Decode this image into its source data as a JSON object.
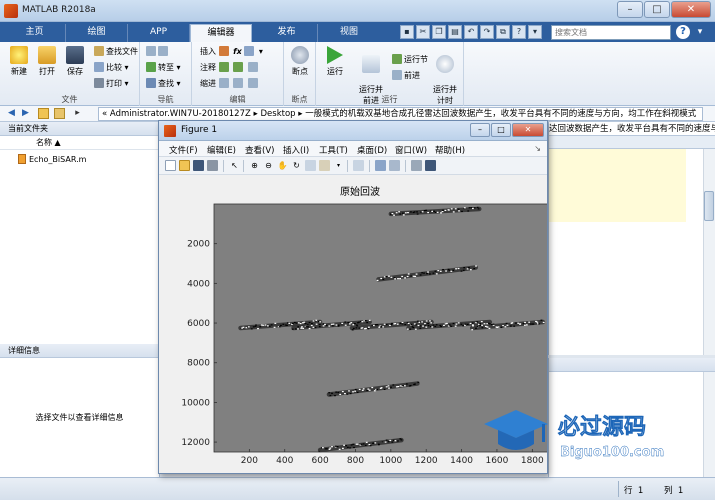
{
  "window": {
    "title": "MATLAB R2018a"
  },
  "tabs": [
    {
      "label": "主页",
      "active": false
    },
    {
      "label": "绘图",
      "active": false
    },
    {
      "label": "APP",
      "active": false
    },
    {
      "label": "编辑器",
      "active": true
    },
    {
      "label": "发布",
      "active": false
    },
    {
      "label": "视图",
      "active": false
    }
  ],
  "search": {
    "placeholder": "搜索文档"
  },
  "ribbon": {
    "file_group": {
      "label": "文件",
      "new": "新建",
      "open": "打开",
      "save": "保存",
      "find_files": "查找文件",
      "compare": "比较",
      "print": "打印"
    },
    "nav_group": {
      "label": "导航",
      "goto": "转至",
      "find": "查找"
    },
    "edit_group": {
      "label": "编辑",
      "insert": "插入",
      "comment": "注释",
      "indent": "缩进",
      "fx": "fx"
    },
    "breakpoint_group": {
      "label": "断点",
      "breakpoints": "断点"
    },
    "run_group": {
      "label": "运行",
      "run": "运行",
      "run_advance": "运行并\n前进",
      "run_section": "运行节",
      "advance": "前进",
      "run_time": "运行并\n计时"
    }
  },
  "address": {
    "path": "« Administrator.WIN7U-20180127Z  ▸  Desktop  ▸  一般模式的机载双基地合成孔径雷达回波数据产生，收发平台具有不同的速度与方向，均工作在斜视模式"
  },
  "current_folder": {
    "title": "当前文件夹",
    "column_name": "名称 ▲",
    "files": [
      "Echo_BiSAR.m"
    ]
  },
  "details": {
    "title": "详细信息",
    "message": "选择文件以查看详细信息"
  },
  "editor": {
    "path_overflow": "达回波数据产生，收发平台具有不同的速度与方向，均工作在斜视模式"
  },
  "status": {
    "row_label": "行",
    "row_value": "1",
    "col_label": "列",
    "col_value": "1"
  },
  "figure": {
    "title": "Figure 1",
    "menu": [
      "文件(F)",
      "编辑(E)",
      "查看(V)",
      "插入(I)",
      "工具(T)",
      "桌面(D)",
      "窗口(W)",
      "帮助(H)"
    ]
  },
  "watermark": {
    "text": "必过源码",
    "url": "Biguo100.com"
  },
  "chart_data": {
    "type": "heatmap",
    "title": "原始回波",
    "xlim": [
      0,
      1900
    ],
    "ylim": [
      0,
      12500
    ],
    "y_reversed": true,
    "xticks": [
      200,
      400,
      600,
      800,
      1000,
      1200,
      1400,
      1600,
      1800
    ],
    "yticks": [
      2000,
      4000,
      6000,
      8000,
      10000,
      12000
    ],
    "background_color": "#808080",
    "stripes": [
      {
        "x": [
          1000,
          1500
        ],
        "y": [
          500,
          250
        ]
      },
      {
        "x": [
          930,
          1480
        ],
        "y": [
          3800,
          3200
        ]
      },
      {
        "x": [
          150,
          600
        ],
        "y": [
          6250,
          5950
        ]
      },
      {
        "x": [
          450,
          880
        ],
        "y": [
          6250,
          5950
        ]
      },
      {
        "x": [
          780,
          1230
        ],
        "y": [
          6250,
          5950
        ]
      },
      {
        "x": [
          1100,
          1560
        ],
        "y": [
          6250,
          5950
        ]
      },
      {
        "x": [
          1460,
          1860
        ],
        "y": [
          6250,
          5950
        ]
      },
      {
        "x": [
          650,
          1150
        ],
        "y": [
          9600,
          9050
        ]
      },
      {
        "x": [
          600,
          1060
        ],
        "y": [
          12400,
          11900
        ]
      }
    ]
  }
}
